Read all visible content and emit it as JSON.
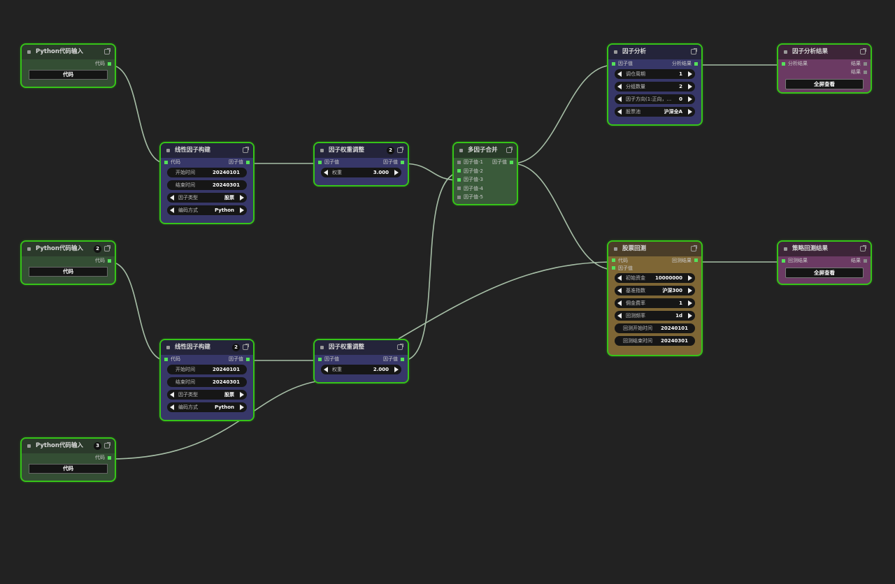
{
  "nodes": {
    "py1": {
      "title": "Python代码输入",
      "out": "代码",
      "button": "代码"
    },
    "py2": {
      "title": "Python代码输入",
      "badge": "2",
      "out": "代码",
      "button": "代码"
    },
    "py3": {
      "title": "Python代码输入",
      "badge": "3",
      "out": "代码",
      "button": "代码"
    },
    "lin1": {
      "title": "线性因子构建",
      "in": "代码",
      "out": "因子值",
      "start_label": "开始时间",
      "start_value": "20240101",
      "end_label": "结束时间",
      "end_value": "20240301",
      "type_label": "因子类型",
      "type_value": "股票",
      "enc_label": "编码方式",
      "enc_value": "Python"
    },
    "lin2": {
      "title": "线性因子构建",
      "badge": "2",
      "in": "代码",
      "out": "因子值",
      "start_label": "开始时间",
      "start_value": "20240101",
      "end_label": "结束时间",
      "end_value": "20240301",
      "type_label": "因子类型",
      "type_value": "股票",
      "enc_label": "编码方式",
      "enc_value": "Python"
    },
    "w1": {
      "title": "因子权重调整",
      "badge": "2",
      "in": "因子值",
      "out": "因子值",
      "w_label": "权重",
      "w_value": "3.000"
    },
    "w2": {
      "title": "因子权重调整",
      "in": "因子值",
      "out": "因子值",
      "w_label": "权重",
      "w_value": "2.000"
    },
    "merge": {
      "title": "多因子合并",
      "out": "因子值",
      "inputs": [
        "因子值-1",
        "因子值-2",
        "因子值-3",
        "因子值-4",
        "因子值-5"
      ]
    },
    "fa": {
      "title": "因子分析",
      "in": "因子值",
      "out": "分析结果",
      "p1_label": "调仓周期",
      "p1_value": "1",
      "p2_label": "分组数量",
      "p2_value": "2",
      "p3_label": "因子方向(1:正向，...",
      "p3_value": "0",
      "p4_label": "股票池",
      "p4_value": "沪深全A"
    },
    "far": {
      "title": "因子分析结果",
      "in": "分析结果",
      "out1": "结果",
      "out2": "结果",
      "button": "全屏查看"
    },
    "bt": {
      "title": "股票回测",
      "in1": "代码",
      "in2": "因子值",
      "out": "回测结果",
      "p1_label": "初始资金",
      "p1_value": "10000000",
      "p2_label": "基准指数",
      "p2_value": "沪深300",
      "p3_label": "佣金费率",
      "p3_value": "1",
      "p4_label": "回测频率",
      "p4_value": "1d",
      "p5_label": "回测开始时间",
      "p5_value": "20240101",
      "p6_label": "回测结束时间",
      "p6_value": "20240301"
    },
    "btr": {
      "title": "策略回测结果",
      "in": "回测结果",
      "out": "结果",
      "button": "全屏查看"
    }
  },
  "colors": {
    "canvas": "#222222",
    "node_border": "#36c418",
    "wire": "#a9c4a9",
    "port": "#55e05a"
  }
}
